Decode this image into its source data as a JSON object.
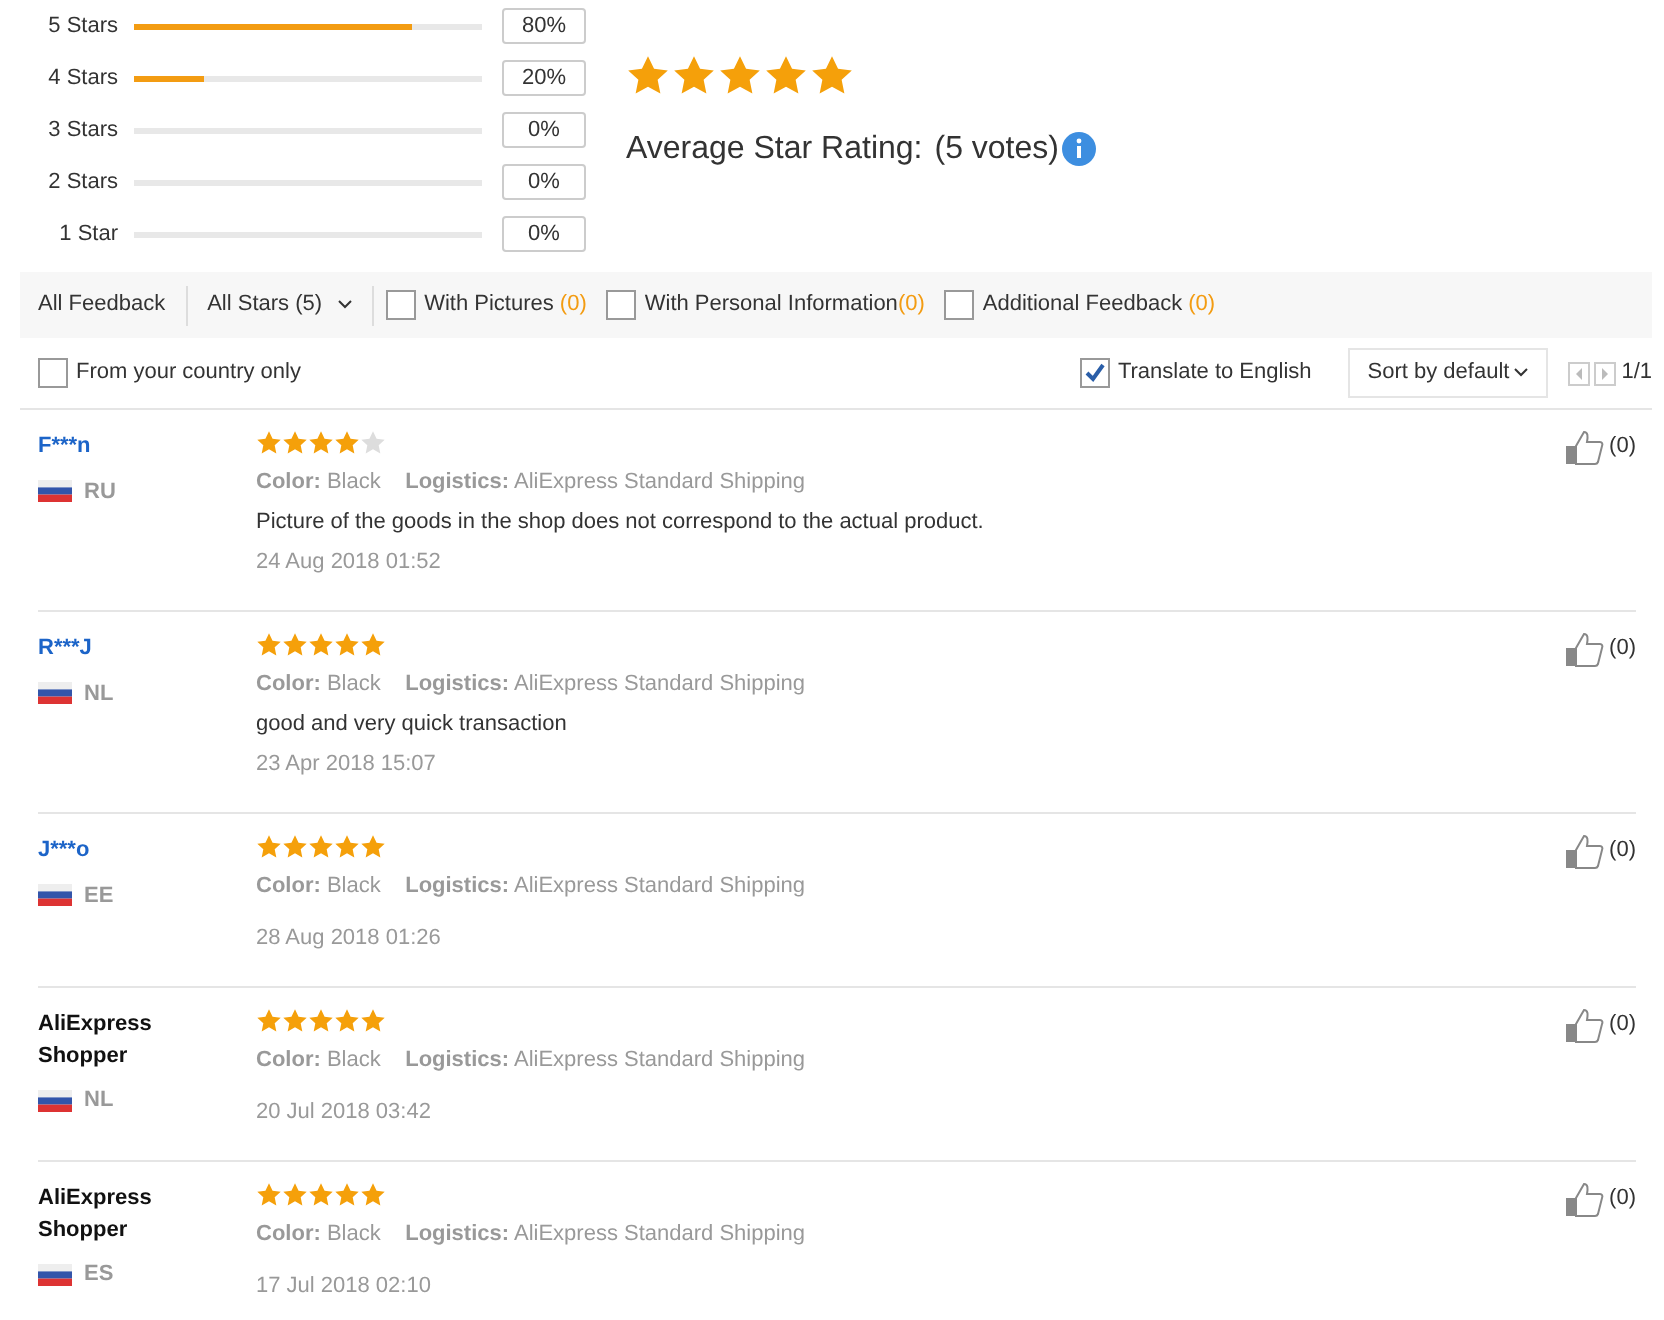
{
  "breakdown": [
    {
      "label": "5 Stars",
      "level": 0.8,
      "percent": "80%"
    },
    {
      "label": "4 Stars",
      "level": 0.2,
      "percent": "20%"
    },
    {
      "label": "3 Stars",
      "percent": "0%"
    },
    {
      "label": "2 Stars",
      "percent": "0%"
    },
    {
      "label": "1 Star",
      "percent": "0%"
    }
  ],
  "summary": {
    "stars": 5,
    "label": "Average Star Rating:",
    "votes": "(5 votes)"
  },
  "filter_bar": {
    "all_feedback": "All Feedback",
    "star_filter": "All Stars (5)",
    "checkboxes": [
      {
        "label": "With Pictures ",
        "count": "(0)",
        "checked": false
      },
      {
        "label": "With Personal Information",
        "count": "(0)",
        "checked": false
      },
      {
        "label": "Additional Feedback ",
        "count": "(0)",
        "checked": false
      }
    ]
  },
  "options_bar": {
    "country_filter": {
      "label": "From your country only",
      "checked": false
    },
    "translate": {
      "label": "Translate to English",
      "checked": true
    },
    "sort": "Sort by default",
    "pages": "1/1"
  },
  "reviews": [
    {
      "name": "F***n",
      "kind": "buyer",
      "country": "RU",
      "stars": 4,
      "color_label": "Color:",
      "color_value": "Black",
      "logistics_label": "Logistics:",
      "logistics": "AliExpress Standard Shipping",
      "comment": "Picture of the goods in the shop does not correspond to the actual product.",
      "date": "24 Aug 2018 01:52",
      "helpful": "(0)"
    },
    {
      "name": "R***J",
      "kind": "buyer",
      "country": "NL",
      "stars": 5,
      "color_label": "Color:",
      "color_value": "Black",
      "logistics_label": "Logistics:",
      "logistics": "AliExpress Standard Shipping",
      "comment": "good and very quick transaction",
      "date": "23 Apr 2018 15:07",
      "helpful": "(0)"
    },
    {
      "name": "J***o",
      "kind": "buyer",
      "country": "EE",
      "stars": 5,
      "color_label": "Color:",
      "color_value": "Black",
      "logistics_label": "Logistics:",
      "logistics": "AliExpress Standard Shipping",
      "date": "28 Aug 2018 01:26",
      "helpful": "(0)"
    },
    {
      "name": "AliExpress Shopper",
      "kind": "anonymous",
      "country": "NL",
      "stars": 5,
      "color_label": "Color:",
      "color_value": "Black",
      "logistics_label": "Logistics:",
      "logistics": "AliExpress Standard Shipping",
      "date": "20 Jul 2018 03:42",
      "helpful": "(0)"
    },
    {
      "name": "AliExpress Shopper",
      "kind": "anonymous",
      "country": "ES",
      "stars": 5,
      "color_label": "Color:",
      "color_value": "Black",
      "logistics_label": "Logistics:",
      "logistics": "AliExpress Standard Shipping",
      "date": "17 Jul 2018 02:10",
      "helpful": "(0)"
    }
  ]
}
